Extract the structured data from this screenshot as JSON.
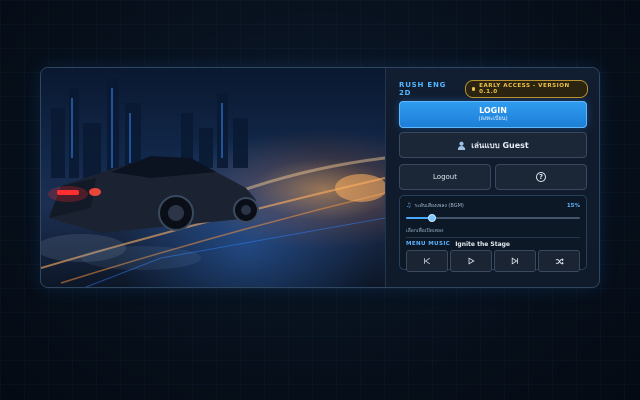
{
  "header": {
    "brand": "RUSH ENG 2D",
    "badge": "EARLY ACCESS - VERSION 0.1.0"
  },
  "auth": {
    "login_label": "LOGIN",
    "login_sublabel": "(ลงทะเบียน)",
    "guest_label": "เล่นแบบ Guest",
    "logout_label": "Logout"
  },
  "audio": {
    "bgm_label": "ระดับเสียงเพลง (BGM)",
    "bgm_value_text": "15%",
    "bgm_level": 0.15,
    "effects_label": "เลือกเพื่อเปิดเพลง",
    "menu_music_key": "MENU MUSIC",
    "menu_music_track": "Ignite the Stage"
  },
  "icons": {
    "guest": "person-icon",
    "help": "question-circle-icon",
    "prev": "skip-previous-icon",
    "play": "play-icon",
    "next": "skip-next-icon",
    "shuffle": "shuffle-icon"
  },
  "colors": {
    "accent": "#2f9cf0",
    "badge_gold": "#f0c445",
    "brand_blue": "#54b6ff"
  }
}
